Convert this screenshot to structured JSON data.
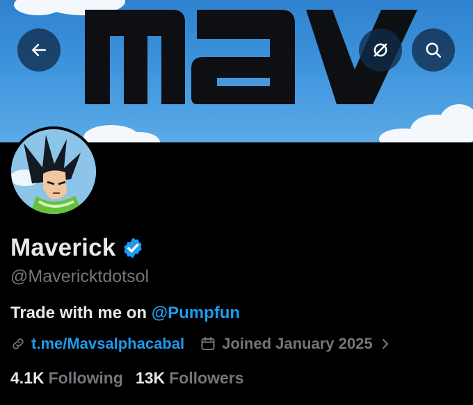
{
  "banner": {
    "logo_text": "MAV"
  },
  "header": {
    "back_icon": "arrow-left-icon",
    "mute_icon": "notifications-off-icon",
    "search_icon": "search-icon"
  },
  "profile": {
    "display_name": "Maverick",
    "verified": true,
    "handle": "@Mavericktdotsol",
    "bio_text": "Trade with me on ",
    "bio_mention": "@Pumpfun",
    "link": "t.me/Mavsalphacabal",
    "joined": "Joined January 2025",
    "following_count": "4.1K",
    "following_label": "Following",
    "followers_count": "13K",
    "followers_label": "Followers"
  },
  "colors": {
    "accent": "#1d9bf0",
    "muted": "#71767b",
    "text": "#e7e9ea",
    "background": "#000000"
  }
}
